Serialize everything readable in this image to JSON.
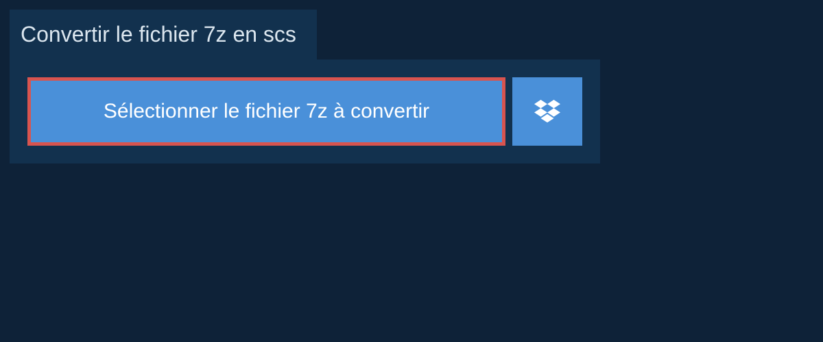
{
  "header": {
    "title": "Convertir le fichier 7z en scs"
  },
  "actions": {
    "select_file_label": "Sélectionner le fichier 7z à convertir"
  }
}
